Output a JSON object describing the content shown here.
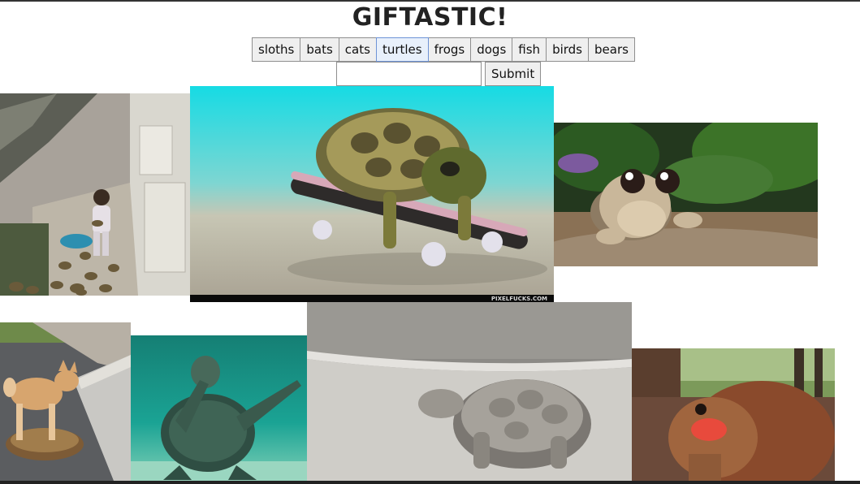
{
  "header": {
    "title": "GIFTASTIC!"
  },
  "topics": [
    {
      "label": "sloths"
    },
    {
      "label": "bats"
    },
    {
      "label": "cats"
    },
    {
      "label": "turtles",
      "active": true
    },
    {
      "label": "frogs"
    },
    {
      "label": "dogs"
    },
    {
      "label": "fish"
    },
    {
      "label": "birds"
    },
    {
      "label": "bears"
    }
  ],
  "form": {
    "input_value": "",
    "submit_label": "Submit"
  },
  "gifs": {
    "watermark": "PIXELFUCKS.COM"
  },
  "colors": {
    "active_button_border": "#6e93d6",
    "button_bg": "#efefef",
    "water": "#1ec7c9"
  }
}
